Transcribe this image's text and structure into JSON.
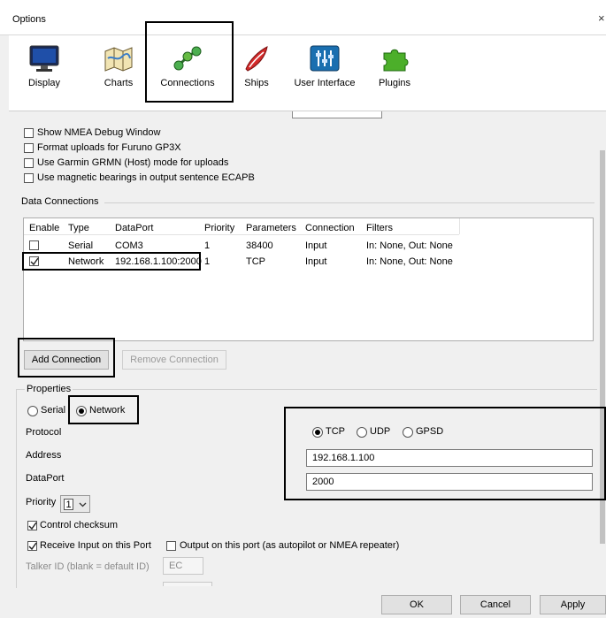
{
  "window": {
    "title": "Options",
    "close_glyph": "×"
  },
  "toolbar": {
    "items": [
      {
        "label": "Display",
        "icon": "display-icon"
      },
      {
        "label": "Charts",
        "icon": "charts-icon"
      },
      {
        "label": "Connections",
        "icon": "connections-icon"
      },
      {
        "label": "Ships",
        "icon": "ships-icon"
      },
      {
        "label": "User Interface",
        "icon": "user-interface-icon"
      },
      {
        "label": "Plugins",
        "icon": "plugins-icon"
      }
    ],
    "selected": "Connections"
  },
  "general_options": [
    {
      "label": "Show NMEA Debug Window",
      "checked": false
    },
    {
      "label": "Format uploads for Furuno GP3X",
      "checked": false
    },
    {
      "label": "Use Garmin GRMN (Host) mode for uploads",
      "checked": false
    },
    {
      "label": "Use magnetic bearings in output sentence ECAPB",
      "checked": false
    }
  ],
  "data_connections": {
    "title": "Data Connections",
    "headers": [
      "Enable",
      "Type",
      "DataPort",
      "Priority",
      "Parameters",
      "Connection",
      "Filters"
    ],
    "rows": [
      {
        "enabled": false,
        "type": "Serial",
        "dataport": "COM3",
        "priority": "1",
        "parameters": "38400",
        "connection": "Input",
        "filters": "In: None, Out: None"
      },
      {
        "enabled": true,
        "type": "Network",
        "dataport": "192.168.1.100:2000",
        "priority": "1",
        "parameters": "TCP",
        "connection": "Input",
        "filters": "In: None, Out: None"
      }
    ],
    "add_button": "Add Connection",
    "remove_button": "Remove Connection"
  },
  "properties": {
    "title": "Properties",
    "type_options": [
      "Serial",
      "Network"
    ],
    "type_selected": "Network",
    "protocol_label": "Protocol",
    "protocol_options": [
      "TCP",
      "UDP",
      "GPSD"
    ],
    "protocol_selected": "TCP",
    "address_label": "Address",
    "address_value": "192.168.1.100",
    "dataport_label": "DataPort",
    "dataport_value": "2000",
    "priority_label": "Priority",
    "priority_value": "1",
    "control_checksum": {
      "label": "Control checksum",
      "checked": true
    },
    "receive_input": {
      "label": "Receive Input on this Port",
      "checked": true
    },
    "output_port": {
      "label": "Output on this port (as autopilot or NMEA repeater)",
      "checked": false
    },
    "talker_label": "Talker ID (blank = default ID)",
    "talker_value": "EC"
  },
  "footer": {
    "ok": "OK",
    "cancel": "Cancel",
    "apply": "Apply"
  }
}
